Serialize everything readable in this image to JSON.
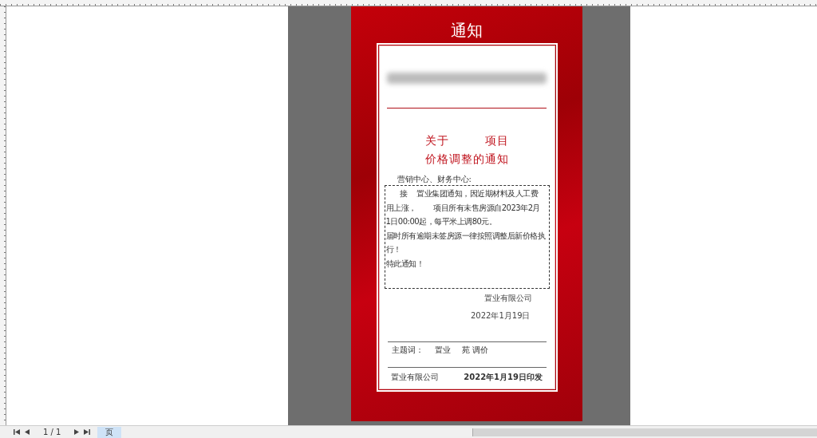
{
  "document": {
    "banner_title": "通知",
    "heading_lines": [
      "关于　　　项目",
      "价格调整的通知"
    ],
    "addressee": "营销中心、财务中心:",
    "body_lines": [
      "接　 置业集团通知，因近期材料及人工费",
      "用上涨，　　 项目所有未售房源自2023年2月",
      "1日00:00起，每平米上调80元。",
      "届时所有逾期未签房源一律按照调整后新价格执",
      "行！",
      "特此通知！"
    ],
    "signature": "置业有限公司",
    "date": "2022年1月19日",
    "subject_label": "主题词：",
    "subject_terms": [
      "置业",
      "苑 调价"
    ],
    "issuer": "置业有限公司",
    "issue_date": "2022年1月19日印发"
  },
  "status_bar": {
    "page_counter": "1 / 1",
    "page_tab": {
      "label": "页",
      "selected": true
    }
  }
}
